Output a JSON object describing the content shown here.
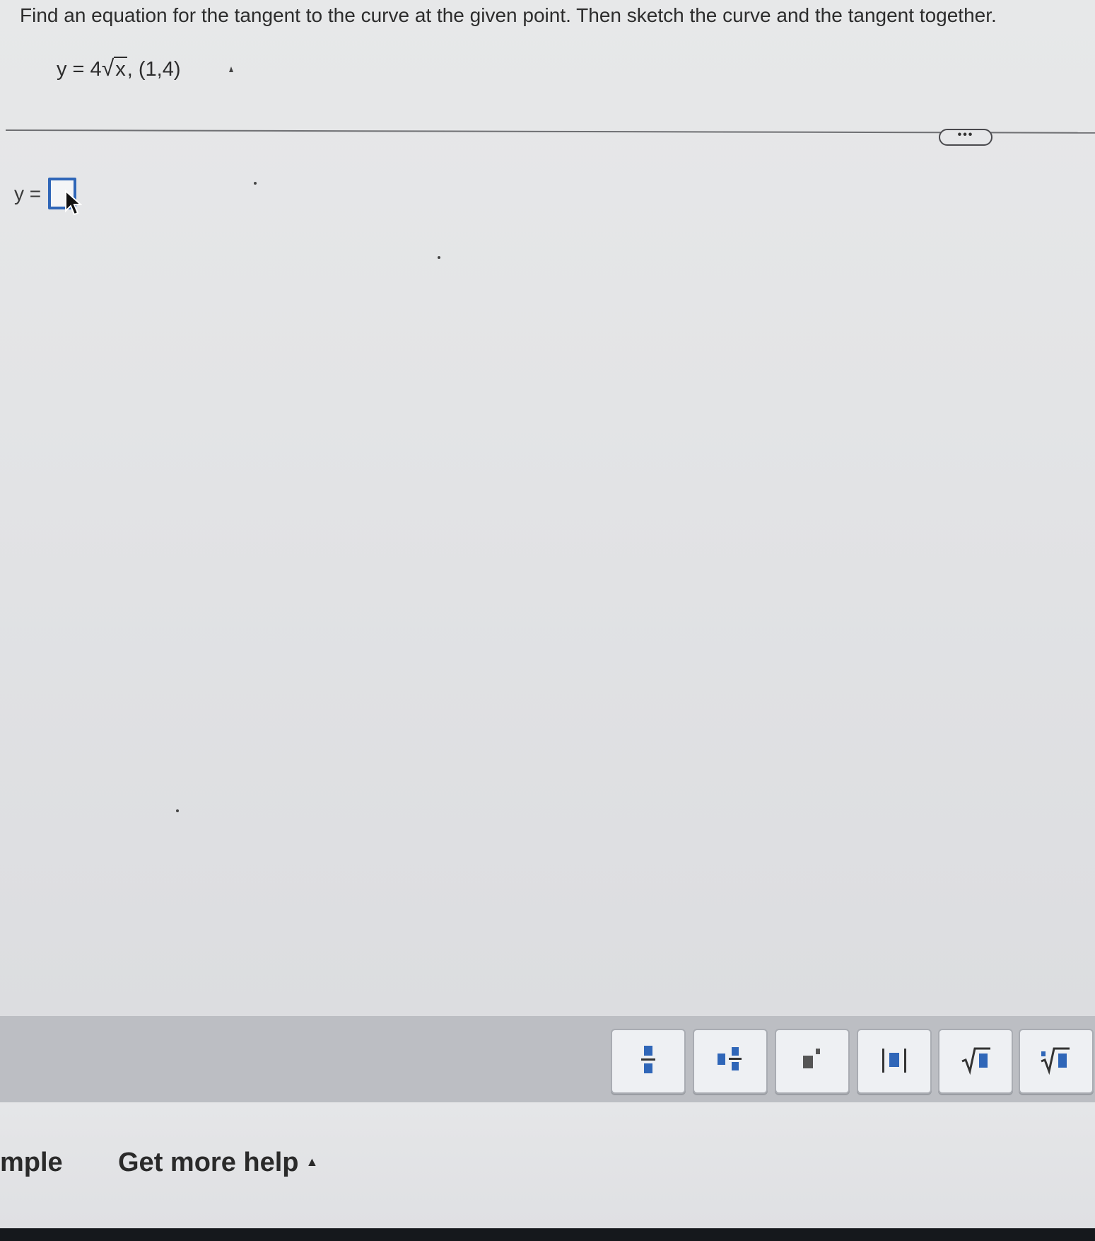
{
  "question": {
    "prompt": "Find an equation for the tangent to the curve at the given point. Then sketch the curve and the tangent together.",
    "equation_prefix": "y = 4",
    "equation_radicand": "x",
    "equation_point": ", (1,4)"
  },
  "answer": {
    "label": "y =",
    "value": ""
  },
  "more_button": {
    "label": "•••"
  },
  "toolbar": {
    "buttons": [
      {
        "icon": "fraction-icon"
      },
      {
        "icon": "mixed-number-icon"
      },
      {
        "icon": "exponent-icon"
      },
      {
        "icon": "absolute-value-icon"
      },
      {
        "icon": "square-root-icon"
      },
      {
        "icon": "nth-root-icon"
      }
    ],
    "accent_color": "#2f66b8"
  },
  "footer": {
    "example_label": "mple",
    "help_label": "Get more help",
    "help_caret": "▲"
  }
}
